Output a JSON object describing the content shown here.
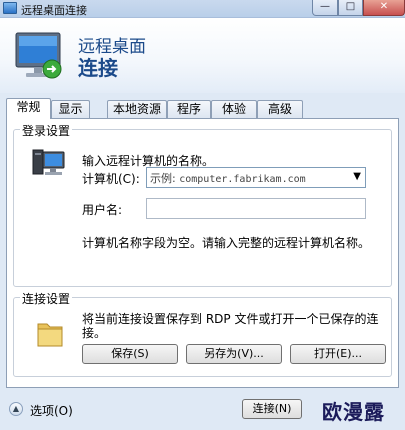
{
  "window": {
    "title": "远程桌面连接",
    "min_glyph": "—",
    "max_glyph": "□",
    "close_glyph": "✕"
  },
  "banner": {
    "line1": "远程桌面",
    "line2": "连接"
  },
  "tabs": [
    {
      "label": "常规",
      "active": true
    },
    {
      "label": "显示"
    },
    {
      "label": "本地资源"
    },
    {
      "label": "程序"
    },
    {
      "label": "体验"
    },
    {
      "label": "高级"
    }
  ],
  "login": {
    "group_title": "登录设置",
    "prompt": "输入远程计算机的名称。",
    "computer_label": "计算机(C):",
    "computer_placeholder_prefix": "示例:",
    "computer_placeholder_value": "computer.fabrikam.com",
    "username_label": "用户名:",
    "username_value": "",
    "note": "计算机名称字段为空。请输入完整的远程计算机名称。"
  },
  "connection": {
    "group_title": "连接设置",
    "desc_line1": "将当前连接设置保存到 RDP 文件或打开一个已保存的连",
    "desc_line2": "接。",
    "save_label": "保存(S)",
    "save_as_label": "另存为(V)...",
    "open_label": "打开(E)..."
  },
  "footer": {
    "options_label": "选项(O)",
    "connect_label": "连接(N)",
    "watermark": "欧漫露"
  },
  "icons": {
    "app": "remote-desktop-icon",
    "computer": "computer-icon",
    "folder": "folder-icon",
    "options": "chevron-up-icon",
    "dropdown": "chevron-down-icon"
  },
  "colors": {
    "title_text": "#1b4a8a",
    "close_button": "#c75050",
    "window_bg": "#dfe9f5"
  }
}
